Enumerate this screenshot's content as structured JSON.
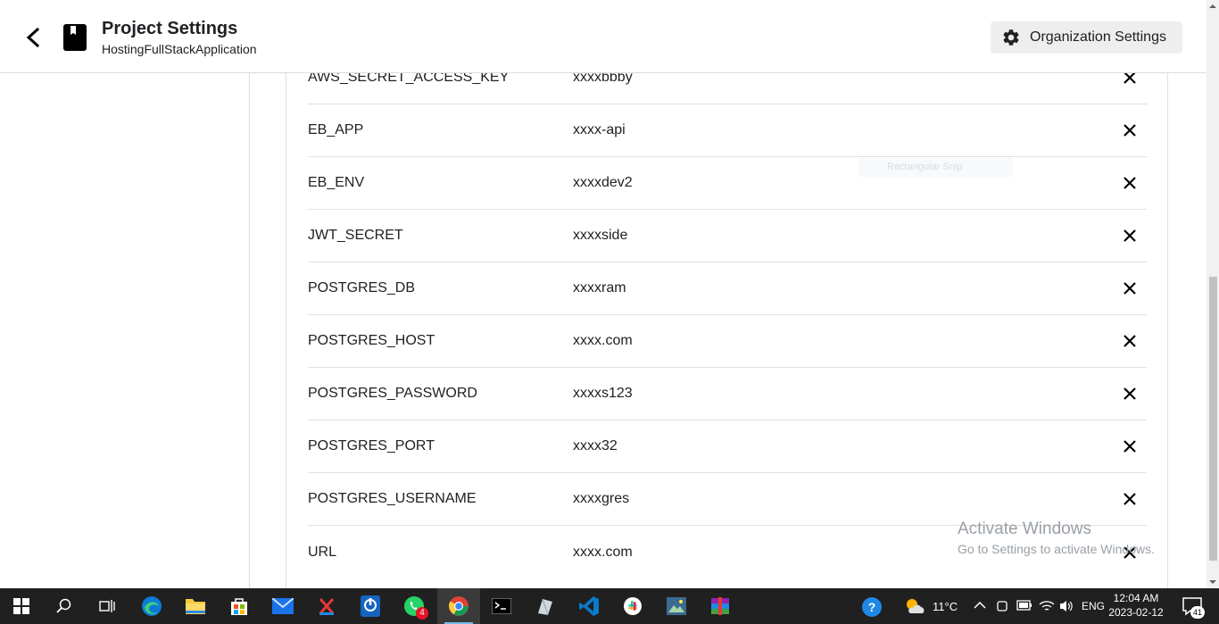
{
  "header": {
    "title": "Project Settings",
    "subtitle": "HostingFullStackApplication",
    "org_button_label": "Organization Settings"
  },
  "env_vars": [
    {
      "key": "AWS_SECRET_ACCESS_KEY",
      "value": "xxxxbbby"
    },
    {
      "key": "EB_APP",
      "value": "xxxx-api"
    },
    {
      "key": "EB_ENV",
      "value": "xxxxdev2"
    },
    {
      "key": "JWT_SECRET",
      "value": "xxxxside"
    },
    {
      "key": "POSTGRES_DB",
      "value": "xxxxram"
    },
    {
      "key": "POSTGRES_HOST",
      "value": "xxxx.com"
    },
    {
      "key": "POSTGRES_PASSWORD",
      "value": "xxxxs123"
    },
    {
      "key": "POSTGRES_PORT",
      "value": "xxxx32"
    },
    {
      "key": "POSTGRES_USERNAME",
      "value": "xxxxgres"
    },
    {
      "key": "URL",
      "value": "xxxx.com"
    }
  ],
  "overlay": {
    "ghost_label": "Rectangular Snip",
    "activate_title": "Activate Windows",
    "activate_sub": "Go to Settings to activate Windows."
  },
  "taskbar": {
    "apps": [
      "start",
      "search",
      "task-view",
      "edge",
      "file-explorer",
      "store",
      "mail",
      "app-x",
      "power-app",
      "whatsapp",
      "chrome",
      "terminal",
      "app-feather",
      "vscode",
      "slack",
      "photos",
      "winrar"
    ],
    "whatsapp_badge": "4",
    "weather": "11°C",
    "language": "ENG",
    "time": "12:04 AM",
    "date": "2023-02-12",
    "notification_count": "41"
  },
  "colors": {
    "taskbar_bg": "#202020",
    "accent": "#76b9ed",
    "divider": "#e0e0e0"
  }
}
